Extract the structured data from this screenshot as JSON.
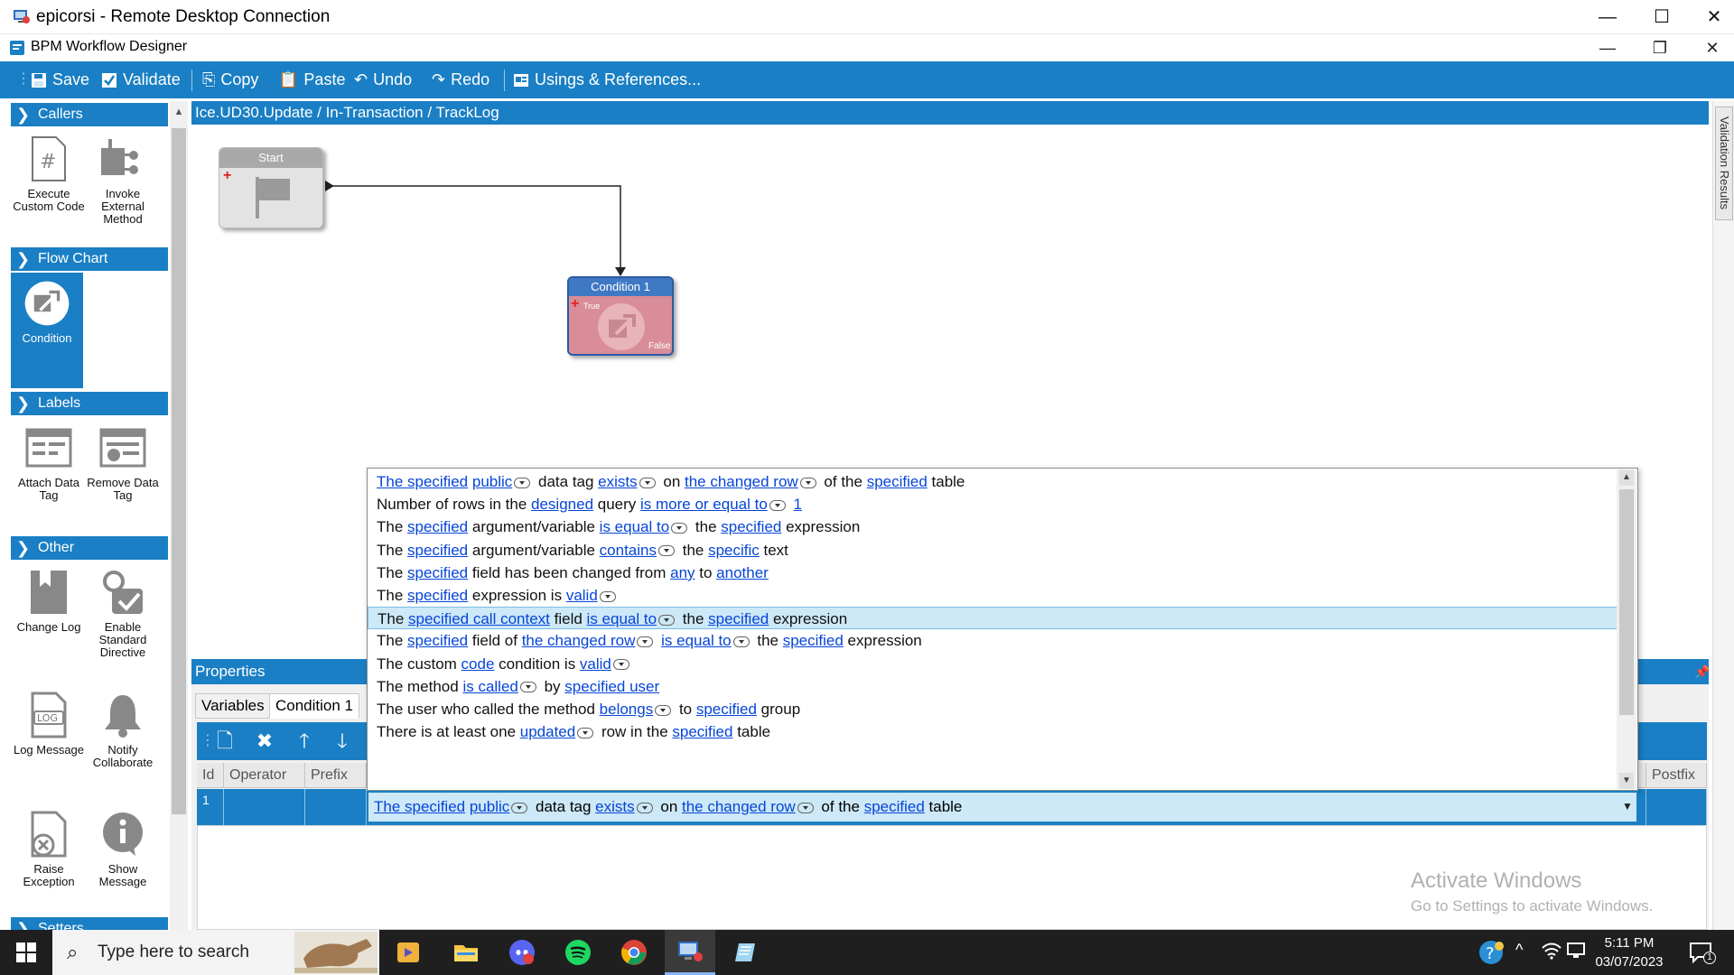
{
  "rdp_window": {
    "title": "epicorsi - Remote Desktop Connection"
  },
  "app_window": {
    "title": "BPM Workflow Designer"
  },
  "toolbar": {
    "save": "Save",
    "validate": "Validate",
    "copy": "Copy",
    "paste": "Paste",
    "undo": "Undo",
    "redo": "Redo",
    "usings": "Usings & References..."
  },
  "palette": {
    "callers": {
      "header": "Callers",
      "items": [
        {
          "label": "Execute Custom Code",
          "icon": "hash-document-icon"
        },
        {
          "label": "Invoke External Method",
          "icon": "external-method-icon"
        }
      ]
    },
    "flow_chart": {
      "header": "Flow Chart",
      "items": [
        {
          "label": "Condition",
          "icon": "condition-icon"
        }
      ]
    },
    "labels": {
      "header": "Labels",
      "items": [
        {
          "label": "Attach Data Tag",
          "icon": "attach-tag-icon"
        },
        {
          "label": "Remove Data Tag",
          "icon": "remove-tag-icon"
        }
      ]
    },
    "other": {
      "header": "Other",
      "items": [
        {
          "label": "Change Log",
          "icon": "change-log-icon"
        },
        {
          "label": "Enable Standard Directive",
          "icon": "enable-directive-icon"
        },
        {
          "label": "Log Message",
          "icon": "log-message-icon"
        },
        {
          "label": "Notify Collaborate",
          "icon": "bell-icon"
        },
        {
          "label": "Raise Exception",
          "icon": "raise-exception-icon"
        },
        {
          "label": "Show Message",
          "icon": "info-icon"
        }
      ]
    },
    "setters": {
      "header": "Setters"
    }
  },
  "breadcrumb": "Ice.UD30.Update / In-Transaction / TrackLog",
  "validation_tab": "Validation Results",
  "canvas": {
    "start_node": {
      "title": "Start"
    },
    "condition_node": {
      "title": "Condition 1",
      "true_label": "True",
      "false_label": "False"
    }
  },
  "properties": {
    "header": "Properties",
    "tabs": [
      "Variables",
      "Condition 1"
    ],
    "columns": [
      "Id",
      "Operator",
      "Prefix",
      "Postfix"
    ],
    "row": {
      "id": "1"
    }
  },
  "condition_list": [
    [
      {
        "t": "The specified",
        "l": true
      },
      {
        "t": " "
      },
      {
        "t": "public",
        "l": true,
        "dd": true
      },
      {
        "t": " data tag "
      },
      {
        "t": "exists",
        "l": true,
        "dd": true
      },
      {
        "t": " on "
      },
      {
        "t": "the changed row",
        "l": true,
        "dd": true
      },
      {
        "t": " of the "
      },
      {
        "t": "specified",
        "l": true
      },
      {
        "t": " table"
      }
    ],
    [
      {
        "t": "Number of rows in the "
      },
      {
        "t": "designed",
        "l": true
      },
      {
        "t": " query "
      },
      {
        "t": "is more or equal to",
        "l": true,
        "dd": true
      },
      {
        "t": " "
      },
      {
        "t": "1",
        "l": true
      }
    ],
    [
      {
        "t": "The "
      },
      {
        "t": "specified",
        "l": true
      },
      {
        "t": " argument/variable "
      },
      {
        "t": "is equal to",
        "l": true,
        "dd": true
      },
      {
        "t": " the "
      },
      {
        "t": "specified",
        "l": true
      },
      {
        "t": " expression"
      }
    ],
    [
      {
        "t": "The "
      },
      {
        "t": "specified",
        "l": true
      },
      {
        "t": " argument/variable "
      },
      {
        "t": "contains",
        "l": true,
        "dd": true
      },
      {
        "t": " the "
      },
      {
        "t": "specific",
        "l": true
      },
      {
        "t": " text"
      }
    ],
    [
      {
        "t": "The "
      },
      {
        "t": "specified",
        "l": true
      },
      {
        "t": " field has been changed from "
      },
      {
        "t": "any",
        "l": true
      },
      {
        "t": " to "
      },
      {
        "t": "another",
        "l": true
      }
    ],
    [
      {
        "t": "The "
      },
      {
        "t": "specified",
        "l": true
      },
      {
        "t": " expression is "
      },
      {
        "t": "valid",
        "l": true,
        "dd": true
      }
    ],
    [
      {
        "t": "The "
      },
      {
        "t": "specified call context",
        "l": true
      },
      {
        "t": " field "
      },
      {
        "t": "is equal to",
        "l": true,
        "dd": true
      },
      {
        "t": " the "
      },
      {
        "t": "specified",
        "l": true
      },
      {
        "t": " expression"
      }
    ],
    [
      {
        "t": "The "
      },
      {
        "t": "specified",
        "l": true
      },
      {
        "t": " field of "
      },
      {
        "t": "the changed row",
        "l": true,
        "dd": true
      },
      {
        "t": " "
      },
      {
        "t": "is equal to",
        "l": true,
        "dd": true
      },
      {
        "t": " the "
      },
      {
        "t": "specified",
        "l": true
      },
      {
        "t": " expression"
      }
    ],
    [
      {
        "t": "The custom "
      },
      {
        "t": "code",
        "l": true
      },
      {
        "t": " condition is "
      },
      {
        "t": "valid",
        "l": true,
        "dd": true
      }
    ],
    [
      {
        "t": "The method "
      },
      {
        "t": "is called",
        "l": true,
        "dd": true
      },
      {
        "t": " by "
      },
      {
        "t": "specified user",
        "l": true
      }
    ],
    [
      {
        "t": "The user who called the method "
      },
      {
        "t": "belongs",
        "l": true,
        "dd": true
      },
      {
        "t": " to "
      },
      {
        "t": "specified",
        "l": true
      },
      {
        "t": " group"
      }
    ],
    [
      {
        "t": "There is at least one "
      },
      {
        "t": "updated",
        "l": true,
        "dd": true
      },
      {
        "t": " row in the "
      },
      {
        "t": "specified",
        "l": true
      },
      {
        "t": " table"
      }
    ]
  ],
  "selected_condition_index": 6,
  "combo_value": [
    {
      "t": "The specified",
      "l": true
    },
    {
      "t": " "
    },
    {
      "t": "public",
      "l": true,
      "dd": true
    },
    {
      "t": " data tag "
    },
    {
      "t": "exists",
      "l": true,
      "dd": true
    },
    {
      "t": " on "
    },
    {
      "t": "the changed row",
      "l": true,
      "dd": true
    },
    {
      "t": " of the "
    },
    {
      "t": "specified",
      "l": true
    },
    {
      "t": " table"
    }
  ],
  "watermark": {
    "line1": "Activate Windows",
    "line2": "Go to Settings to activate Windows."
  },
  "taskbar": {
    "search_placeholder": "Type here to search",
    "time": "5:11 PM",
    "date": "03/07/2023",
    "notification_count": "1"
  },
  "colors": {
    "accent": "#1a7fc4",
    "link": "#0645d8",
    "selection": "#cde8f7"
  }
}
